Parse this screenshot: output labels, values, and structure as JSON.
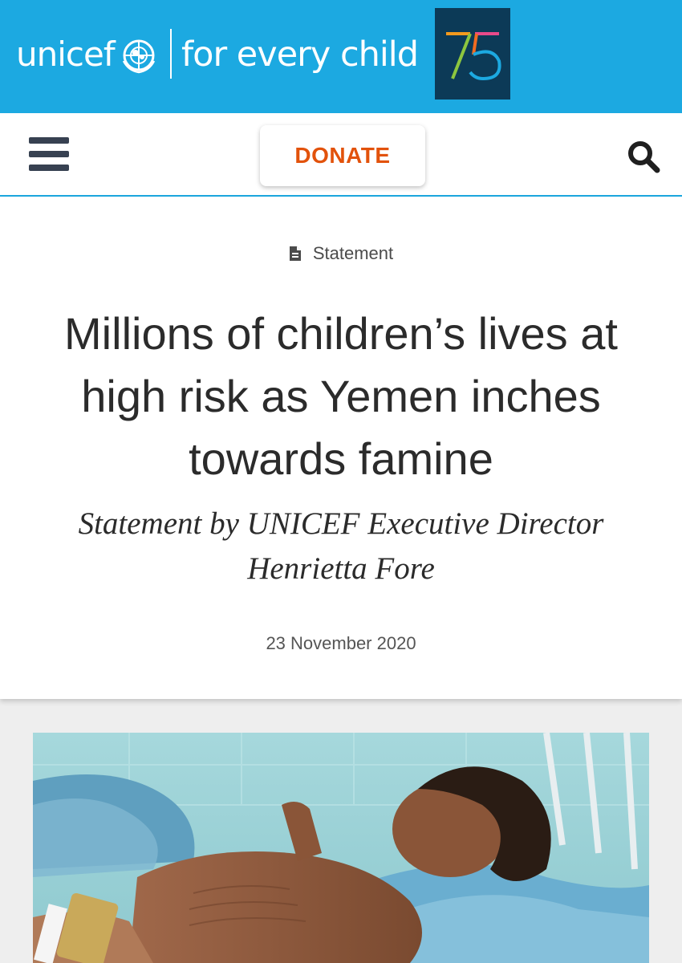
{
  "header": {
    "brand_name": "unicef",
    "tagline": "for every child",
    "anniversary_number": "75"
  },
  "nav": {
    "menu_icon": "hamburger-menu-icon",
    "donate_label": "DONATE",
    "search_icon": "search-icon"
  },
  "article": {
    "type_icon": "document-icon",
    "type_label": "Statement",
    "headline": "Millions of children’s lives at high risk as Yemen inches towards famine",
    "subtitle": "Statement by UNICEF Executive Director Henrietta Fore",
    "date": "23 November 2020"
  },
  "colors": {
    "brand_blue": "#1ca9e1",
    "donate_orange": "#e2520b",
    "badge_navy": "#0c3a57"
  }
}
